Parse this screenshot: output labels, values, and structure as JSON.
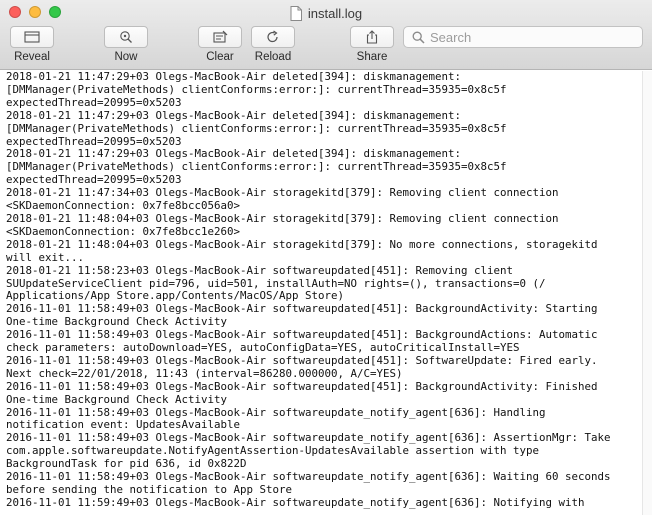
{
  "window": {
    "title": "install.log"
  },
  "toolbar": {
    "reveal_label": "Reveal",
    "now_label": "Now",
    "clear_label": "Clear",
    "reload_label": "Reload",
    "share_label": "Share",
    "search_placeholder": "Search"
  },
  "icons": {
    "reveal": "folder-icon",
    "now": "magnifier-target-icon",
    "clear": "clear-icon",
    "reload": "reload-icon",
    "share": "share-icon",
    "search": "search-icon",
    "document": "document-icon"
  },
  "log": {
    "lines": [
      "2018-01-21 11:47:29+03 Olegs-MacBook-Air deleted[394]: diskmanagement:",
      "[DMManager(PrivateMethods) clientConforms:error:]: currentThread=35935=0x8c5f",
      "expectedThread=20995=0x5203",
      "2018-01-21 11:47:29+03 Olegs-MacBook-Air deleted[394]: diskmanagement:",
      "[DMManager(PrivateMethods) clientConforms:error:]: currentThread=35935=0x8c5f",
      "expectedThread=20995=0x5203",
      "2018-01-21 11:47:29+03 Olegs-MacBook-Air deleted[394]: diskmanagement:",
      "[DMManager(PrivateMethods) clientConforms:error:]: currentThread=35935=0x8c5f",
      "expectedThread=20995=0x5203",
      "2018-01-21 11:47:34+03 Olegs-MacBook-Air storagekitd[379]: Removing client connection",
      "<SKDaemonConnection: 0x7fe8bcc056a0>",
      "2018-01-21 11:48:04+03 Olegs-MacBook-Air storagekitd[379]: Removing client connection",
      "<SKDaemonConnection: 0x7fe8bcc1e260>",
      "2018-01-21 11:48:04+03 Olegs-MacBook-Air storagekitd[379]: No more connections, storagekitd",
      "will exit...",
      "2018-01-21 11:58:23+03 Olegs-MacBook-Air softwareupdated[451]: Removing client",
      "SUUpdateServiceClient pid=796, uid=501, installAuth=NO rights=(), transactions=0 (/",
      "Applications/App Store.app/Contents/MacOS/App Store)",
      "2016-11-01 11:58:49+03 Olegs-MacBook-Air softwareupdated[451]: BackgroundActivity: Starting",
      "One-time Background Check Activity",
      "2016-11-01 11:58:49+03 Olegs-MacBook-Air softwareupdated[451]: BackgroundActions: Automatic",
      "check parameters: autoDownload=YES, autoConfigData=YES, autoCriticalInstall=YES",
      "2016-11-01 11:58:49+03 Olegs-MacBook-Air softwareupdated[451]: SoftwareUpdate: Fired early.",
      "Next check=22/01/2018, 11:43 (interval=86280.000000, A/C=YES)",
      "2016-11-01 11:58:49+03 Olegs-MacBook-Air softwareupdated[451]: BackgroundActivity: Finished",
      "One-time Background Check Activity",
      "2016-11-01 11:58:49+03 Olegs-MacBook-Air softwareupdate_notify_agent[636]: Handling",
      "notification event: UpdatesAvailable",
      "2016-11-01 11:58:49+03 Olegs-MacBook-Air softwareupdate_notify_agent[636]: AssertionMgr: Take",
      "com.apple.softwareupdate.NotifyAgentAssertion-UpdatesAvailable assertion with type",
      "BackgroundTask for pid 636, id 0x822D",
      "2016-11-01 11:58:49+03 Olegs-MacBook-Air softwareupdate_notify_agent[636]: Waiting 60 seconds",
      "before sending the notification to App Store",
      "2016-11-01 11:59:49+03 Olegs-MacBook-Air softwareupdate_notify_agent[636]: Notifying with"
    ]
  }
}
